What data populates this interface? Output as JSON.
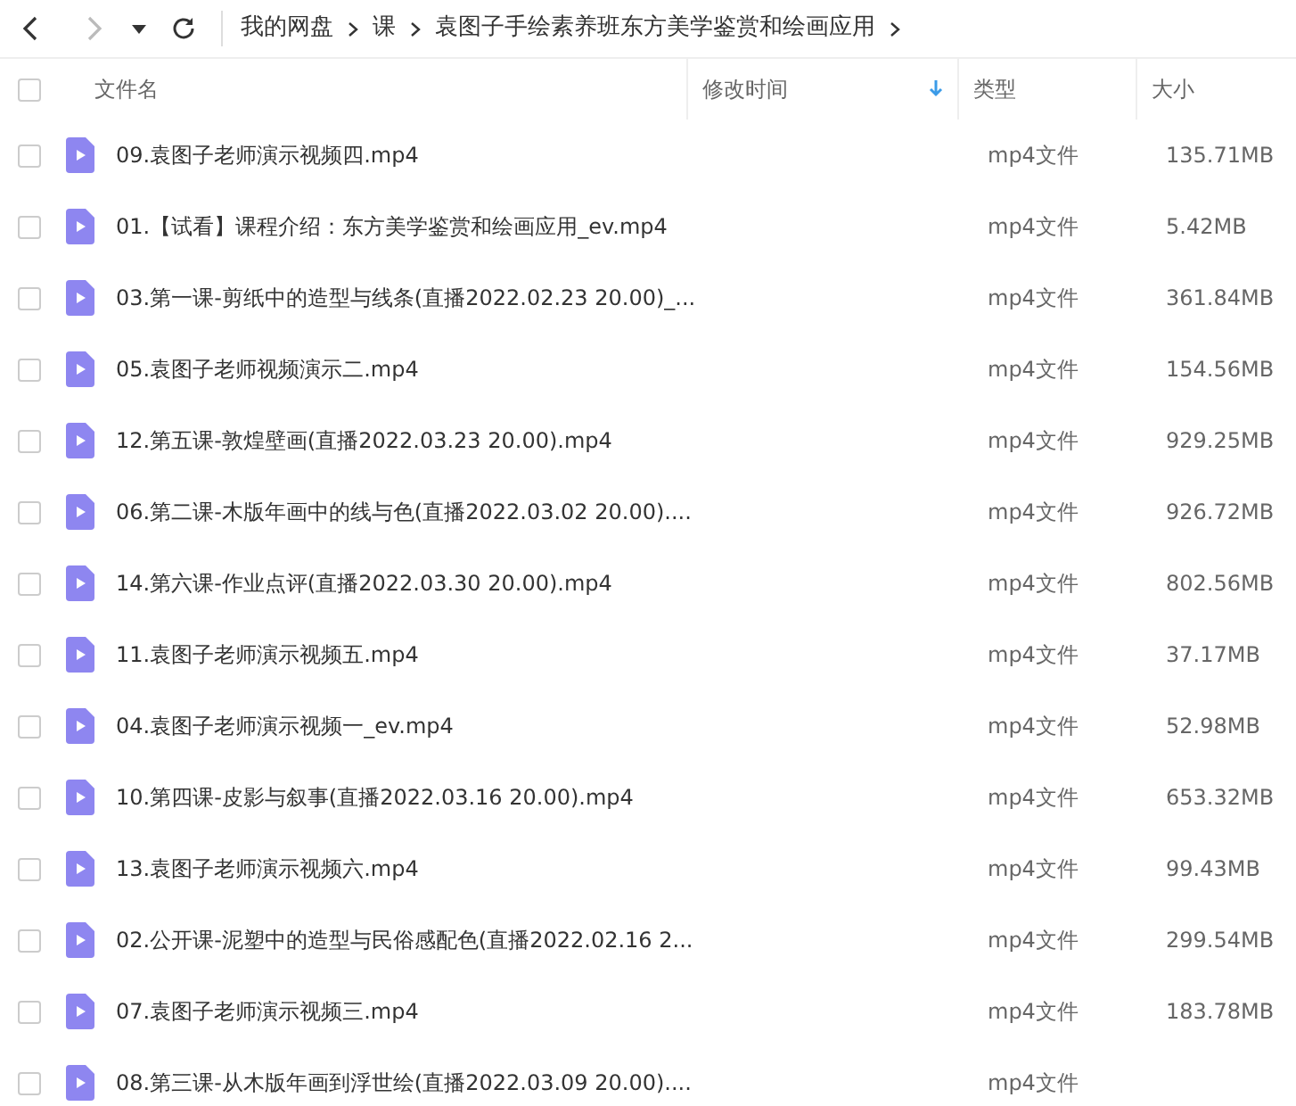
{
  "nav": {
    "breadcrumbs": [
      "我的网盘",
      "课",
      "袁图子手绘素养班东方美学鉴赏和绘画应用"
    ]
  },
  "table": {
    "all_checked": false,
    "columns": [
      {
        "label": "文件名",
        "sorted": false
      },
      {
        "label": "修改时间",
        "sorted": true
      },
      {
        "label": "类型",
        "sorted": false
      },
      {
        "label": "大小",
        "sorted": false
      }
    ],
    "rows": [
      {
        "name": "09.袁图子老师演示视频四.mp4",
        "type": "mp4文件",
        "size": "135.71MB",
        "checked": false
      },
      {
        "name": "01.【试看】课程介绍：东方美学鉴赏和绘画应用_ev.mp4",
        "type": "mp4文件",
        "size": "5.42MB",
        "checked": false
      },
      {
        "name": "03.第一课-剪纸中的造型与线条(直播2022.02.23 20.00)_...",
        "type": "mp4文件",
        "size": "361.84MB",
        "checked": false
      },
      {
        "name": "05.袁图子老师视频演示二.mp4",
        "type": "mp4文件",
        "size": "154.56MB",
        "checked": false
      },
      {
        "name": "12.第五课-敦煌壁画(直播2022.03.23 20.00).mp4",
        "type": "mp4文件",
        "size": "929.25MB",
        "checked": false
      },
      {
        "name": "06.第二课-木版年画中的线与色(直播2022.03.02 20.00)....",
        "type": "mp4文件",
        "size": "926.72MB",
        "checked": false
      },
      {
        "name": "14.第六课-作业点评(直播2022.03.30 20.00).mp4",
        "type": "mp4文件",
        "size": "802.56MB",
        "checked": false
      },
      {
        "name": "11.袁图子老师演示视频五.mp4",
        "type": "mp4文件",
        "size": "37.17MB",
        "checked": false
      },
      {
        "name": "04.袁图子老师演示视频一_ev.mp4",
        "type": "mp4文件",
        "size": "52.98MB",
        "checked": false
      },
      {
        "name": "10.第四课-皮影与叙事(直播2022.03.16 20.00).mp4",
        "type": "mp4文件",
        "size": "653.32MB",
        "checked": false
      },
      {
        "name": "13.袁图子老师演示视频六.mp4",
        "type": "mp4文件",
        "size": "99.43MB",
        "checked": false
      },
      {
        "name": "02.公开课-泥塑中的造型与民俗感配色(直播2022.02.16 2...",
        "type": "mp4文件",
        "size": "299.54MB",
        "checked": false
      },
      {
        "name": "07.袁图子老师演示视频三.mp4",
        "type": "mp4文件",
        "size": "183.78MB",
        "checked": false
      },
      {
        "name": "08.第三课-从木版年画到浮世绘(直播2022.03.09 20.00)....",
        "type": "mp4文件",
        "checked": false
      }
    ]
  }
}
